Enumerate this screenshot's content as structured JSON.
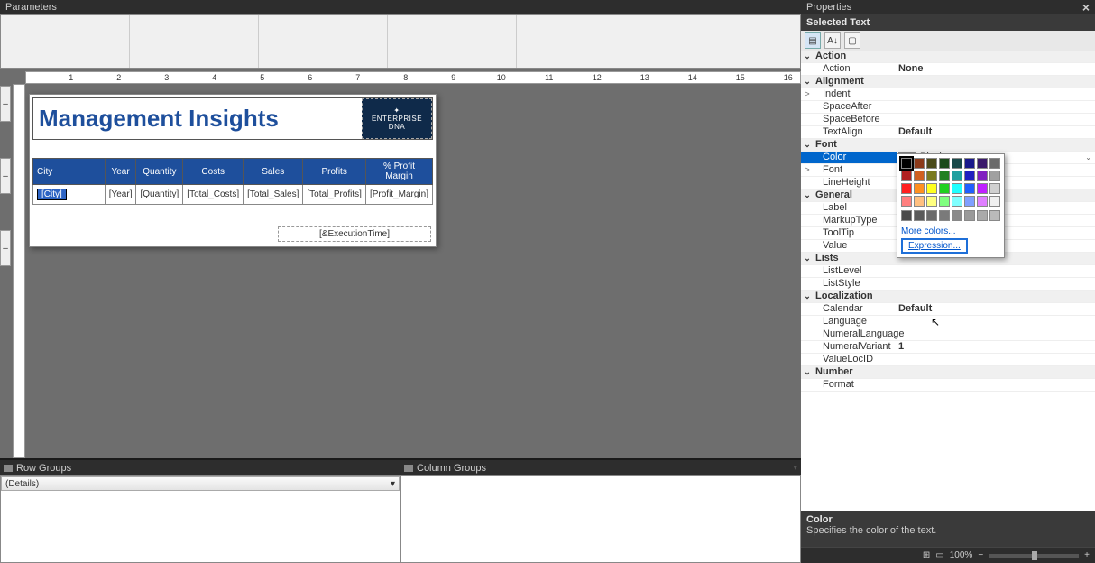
{
  "panels": {
    "parameters_title": "Parameters",
    "properties_title": "Properties",
    "selected_text": "Selected Text",
    "row_groups": "Row Groups",
    "column_groups": "Column Groups",
    "details_row": "(Details)"
  },
  "ruler": [
    "1",
    "2",
    "3",
    "4",
    "5",
    "6",
    "7",
    "8",
    "9",
    "10",
    "11",
    "12",
    "13",
    "14",
    "15",
    "16"
  ],
  "report": {
    "title": "Management Insights",
    "logo_text": "✦ ENTERPRISE DNA",
    "columns": [
      "City",
      "Year",
      "Quantity",
      "Costs",
      "Sales",
      "Profits",
      "% Profit Margin"
    ],
    "data_row": [
      "[City]",
      "[Year]",
      "[Quantity]",
      "[Total_Costs]",
      "[Total_Sales]",
      "[Total_Profits]",
      "[Profit_Margin]"
    ],
    "exec_time": "[&ExecutionTime]"
  },
  "properties": {
    "categories": [
      {
        "name": "Action",
        "items": [
          {
            "n": "Action",
            "v": "None",
            "bold": true
          }
        ]
      },
      {
        "name": "Alignment",
        "items": [
          {
            "n": "Indent",
            "v": "",
            "exp": ">"
          },
          {
            "n": "SpaceAfter",
            "v": ""
          },
          {
            "n": "SpaceBefore",
            "v": ""
          },
          {
            "n": "TextAlign",
            "v": "Default",
            "bold": true
          }
        ]
      },
      {
        "name": "Font",
        "items": [
          {
            "n": "Color",
            "v": "Black",
            "selected": true
          },
          {
            "n": "Font",
            "v": "",
            "exp": ">"
          },
          {
            "n": "LineHeight",
            "v": ""
          }
        ]
      },
      {
        "name": "General",
        "items": [
          {
            "n": "Label",
            "v": ""
          },
          {
            "n": "MarkupType",
            "v": ""
          },
          {
            "n": "ToolTip",
            "v": ""
          },
          {
            "n": "Value",
            "v": ""
          }
        ]
      },
      {
        "name": "Lists",
        "items": [
          {
            "n": "ListLevel",
            "v": ""
          },
          {
            "n": "ListStyle",
            "v": ""
          }
        ]
      },
      {
        "name": "Localization",
        "items": [
          {
            "n": "Calendar",
            "v": "Default",
            "bold": true
          },
          {
            "n": "Language",
            "v": ""
          },
          {
            "n": "NumeralLanguage",
            "v": ""
          },
          {
            "n": "NumeralVariant",
            "v": "1",
            "bold": true
          },
          {
            "n": "ValueLocID",
            "v": ""
          }
        ]
      },
      {
        "name": "Number",
        "items": [
          {
            "n": "Format",
            "v": ""
          }
        ]
      }
    ],
    "desc_title": "Color",
    "desc_body": "Specifies the color of the text."
  },
  "color_popup": {
    "more": "More colors...",
    "expression": "Expression...",
    "rows": [
      [
        "#000000",
        "#8b3a1a",
        "#4a4a1a",
        "#1a4a1a",
        "#1a4a4a",
        "#1a1a8b",
        "#3a1a6b",
        "#6b6b6b"
      ],
      [
        "#b02020",
        "#d06020",
        "#7a7a20",
        "#208020",
        "#20a0a0",
        "#2020c0",
        "#8020c0",
        "#a0a0a0"
      ],
      [
        "#ff2020",
        "#ff9020",
        "#ffff20",
        "#20d020",
        "#20ffff",
        "#2060ff",
        "#c020ff",
        "#d0d0d0"
      ],
      [
        "#ff8080",
        "#ffc080",
        "#ffff80",
        "#80ff80",
        "#80ffff",
        "#80a0ff",
        "#e080ff",
        "#f0f0f0"
      ]
    ],
    "grays": [
      "#4a4a4a",
      "#5a5a5a",
      "#6a6a6a",
      "#7a7a7a",
      "#8a8a8a",
      "#9a9a9a",
      "#aaaaaa",
      "#bababa"
    ]
  },
  "status": {
    "zoom": "100%"
  }
}
